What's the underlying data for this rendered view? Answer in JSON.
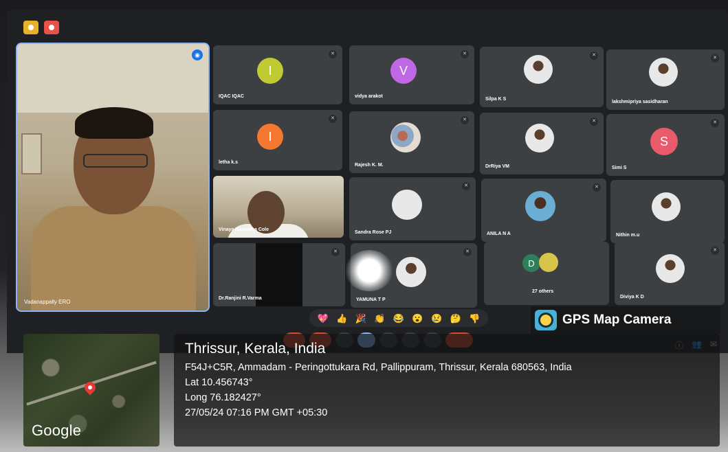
{
  "meeting": {
    "speaker": {
      "name": "Vadanappally ERO"
    },
    "tiles": [
      {
        "name": "IQAC IQAC",
        "avatar": "I",
        "color": "#c0ca33"
      },
      {
        "name": "vidya arakot",
        "avatar": "V",
        "color": "#c067e6"
      },
      {
        "name": "Silpa K S",
        "avatar": "photo"
      },
      {
        "name": "lakshmipriya sasidharan",
        "avatar": "photo"
      },
      {
        "name": "letha k.s",
        "avatar": "I",
        "color": "#f4782f"
      },
      {
        "name": "Rajesh K. M.",
        "avatar": "photo"
      },
      {
        "name": "DrRiya VM",
        "avatar": "photo"
      },
      {
        "name": "Simi S",
        "avatar": "S",
        "color": "#e95a6a"
      },
      {
        "name": "Vinaya Narayana Cole",
        "avatar": "video"
      },
      {
        "name": "Sandra Rose PJ",
        "avatar": "photo"
      },
      {
        "name": "ANILA N A",
        "avatar": "photo"
      },
      {
        "name": "Nithin m.u",
        "avatar": "photo"
      },
      {
        "name": "Dr.Ranjini R.Varma",
        "avatar": "video-dark"
      },
      {
        "name": "YAMUNA T P",
        "avatar": "photo"
      },
      {
        "name": "27 others",
        "avatar": "group",
        "letter": "D"
      },
      {
        "name": "Diviya K D",
        "avatar": "photo"
      }
    ],
    "reactions": [
      "💖",
      "👍",
      "🎉",
      "👏",
      "😂",
      "😮",
      "😢",
      "🤔",
      "👎"
    ]
  },
  "overlay": {
    "app": "GPS Map Camera",
    "map_brand": "Google",
    "city": "Thrissur, Kerala, India",
    "address": "F54J+C5R, Ammadam - Peringottukara Rd, Pallippuram, Thrissur, Kerala 680563, India",
    "lat": "Lat 10.456743°",
    "long": "Long 76.182427°",
    "timestamp": "27/05/24 07:16 PM GMT +05:30"
  }
}
